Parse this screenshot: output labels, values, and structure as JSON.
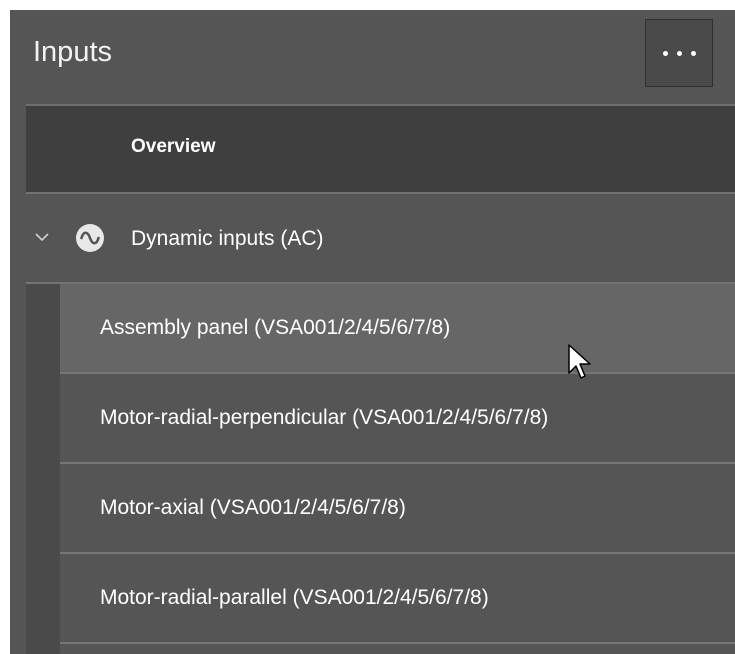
{
  "panel": {
    "title": "Inputs",
    "more_button_icon": "more-horizontal-icon"
  },
  "overview": {
    "label": "Overview"
  },
  "group": {
    "label": "Dynamic inputs (AC)",
    "expanded": true,
    "icon": "ac-sine-wave-icon"
  },
  "items": [
    {
      "label": "Assembly panel (VSA001/2/4/5/6/7/8)",
      "hovered": true
    },
    {
      "label": "Motor-radial-perpendicular (VSA001/2/4/5/6/7/8)",
      "hovered": false
    },
    {
      "label": "Motor-axial (VSA001/2/4/5/6/7/8)",
      "hovered": false
    },
    {
      "label": "Motor-radial-parallel (VSA001/2/4/5/6/7/8)",
      "hovered": false
    }
  ],
  "colors": {
    "panel_bg": "#555555",
    "header_row_bg": "#3f3f3f",
    "hover_bg": "#666666",
    "text": "#ffffff"
  }
}
